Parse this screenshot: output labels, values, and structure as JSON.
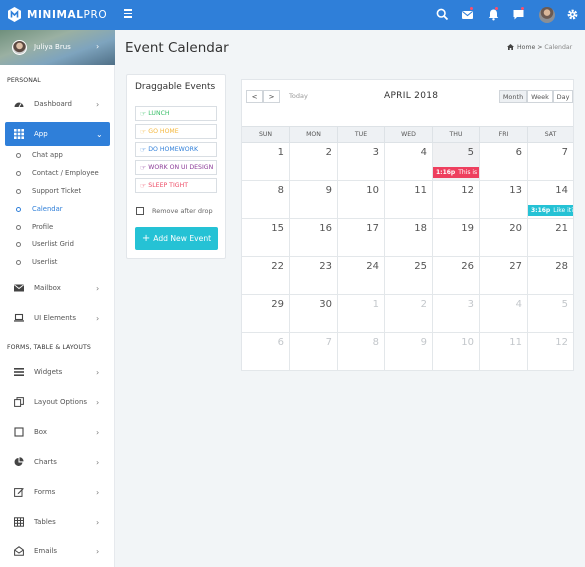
{
  "brand": {
    "name_bold": "MINIMAL",
    "name_light": "PRO"
  },
  "topbar": {
    "icons": [
      {
        "name": "search-icon",
        "dot": false
      },
      {
        "name": "mail-icon",
        "dot": true
      },
      {
        "name": "bell-icon",
        "dot": true
      },
      {
        "name": "chat-icon",
        "dot": true
      },
      {
        "name": "gear-icon",
        "dot": false
      }
    ],
    "accent": "#2f7fd9",
    "badge_color": "#ff4d6a"
  },
  "sidebar": {
    "user_name": "Juliya Brus",
    "section_personal": "PERSONAL",
    "section_forms": "FORMS, TABLE & LAYOUTS",
    "items": {
      "dashboard": "Dashboard",
      "app": "App",
      "mailbox": "Mailbox",
      "ui_elements": "UI Elements",
      "widgets": "Widgets",
      "layout_options": "Layout Options",
      "box": "Box",
      "charts": "Charts",
      "forms": "Forms",
      "tables": "Tables",
      "emails": "Emails"
    },
    "app_sub": [
      "Chat app",
      "Contact / Employee",
      "Support Ticket",
      "Calendar",
      "Profile",
      "Userlist Grid",
      "Userlist"
    ],
    "current_sub": "Calendar"
  },
  "page": {
    "title": "Event Calendar",
    "breadcrumb_home": "Home",
    "breadcrumb_sep": ">",
    "breadcrumb_current": "Calendar"
  },
  "events_panel": {
    "title": "Draggable Events",
    "events": [
      {
        "label": "LUNCH",
        "color": "#3cc06a"
      },
      {
        "label": "GO HOME",
        "color": "#f4b73c"
      },
      {
        "label": "DO HOMEWORK",
        "color": "#2f7fd9"
      },
      {
        "label": "WORK ON UI DESIGN",
        "color": "#8b3a98"
      },
      {
        "label": "SLEEP TIGHT",
        "color": "#ee4d67"
      }
    ],
    "remove_label": "Remove after drop",
    "add_button": "Add New Event"
  },
  "calendar": {
    "prev": "<",
    "next": ">",
    "today_label": "Today",
    "title": "APRIL 2018",
    "views": [
      {
        "label": "Month",
        "active": true
      },
      {
        "label": "Week",
        "active": false
      },
      {
        "label": "Day",
        "active": false
      }
    ],
    "weekdays": [
      "SUN",
      "MON",
      "TUE",
      "WED",
      "THU",
      "FRI",
      "SAT"
    ],
    "weeks": [
      [
        1,
        2,
        3,
        4,
        5,
        6,
        7
      ],
      [
        8,
        9,
        10,
        11,
        12,
        13,
        14
      ],
      [
        15,
        16,
        17,
        18,
        19,
        20,
        21
      ],
      [
        22,
        23,
        24,
        25,
        26,
        27,
        28
      ],
      [
        29,
        30,
        1,
        2,
        3,
        4,
        5
      ],
      [
        6,
        7,
        8,
        9,
        10,
        11,
        12
      ]
    ],
    "today": {
      "week": 0,
      "day": 4
    },
    "events": [
      {
        "week": 0,
        "day": 4,
        "time": "1:16p",
        "text": "This is to",
        "color": "#ee3f5e"
      },
      {
        "week": 1,
        "day": 6,
        "time": "3:16p",
        "text": "Like it?",
        "color": "#25c2d5"
      }
    ]
  }
}
